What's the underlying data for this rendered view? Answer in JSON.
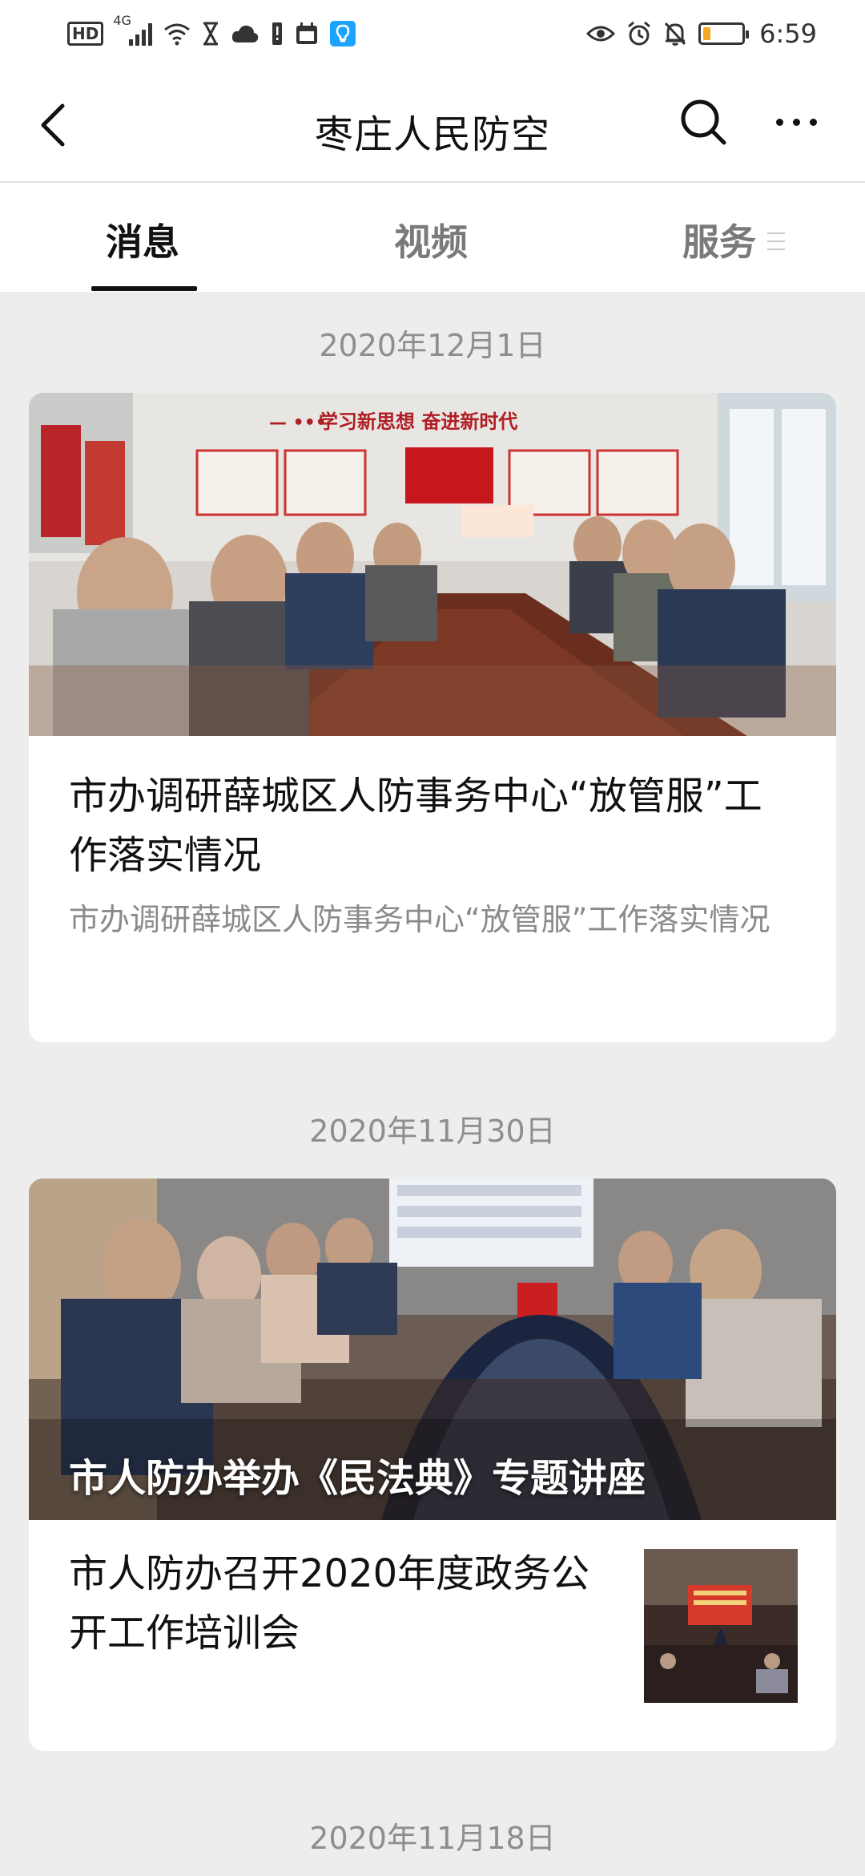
{
  "status_bar": {
    "network": "4G",
    "hd": "HD",
    "time": "6:59",
    "icons": [
      "hd-icon",
      "signal-icon",
      "wifi-icon",
      "hourglass-icon",
      "cloud-icon",
      "alert-icon",
      "calendar-icon",
      "bulb-icon",
      "eye-icon",
      "alarm-icon",
      "mute-icon",
      "battery-icon"
    ],
    "battery_level": 0.2,
    "battery_color": "#f5a623"
  },
  "header": {
    "title": "枣庄人民防空",
    "back_icon": "chevron-left-icon",
    "search_icon": "search-icon",
    "more_icon": "more-dots-icon"
  },
  "tabs": [
    {
      "label": "消息",
      "active": true
    },
    {
      "label": "视频",
      "active": false
    },
    {
      "label": "服务",
      "active": false
    }
  ],
  "feed": [
    {
      "date": "2020年12月1日",
      "articles": [
        {
          "title": "市办调研薛城区人防事务中心“放管服”工作落实情况",
          "summary": "市办调研薛城区人防事务中心“放管服”工作落实情况",
          "banner_text": "学习新思想 奋进新时代"
        }
      ]
    },
    {
      "date": "2020年11月30日",
      "articles": [
        {
          "title": "市人防办举办《民法典》专题讲座"
        },
        {
          "title": "市人防办召开2020年度政务公开工作培训会"
        }
      ]
    },
    {
      "date": "2020年11月18日",
      "articles": []
    }
  ],
  "colors": {
    "background": "#ededed",
    "card": "#ffffff",
    "text": "#111111",
    "muted": "#8a8a8a",
    "date": "#8e8e8e"
  }
}
